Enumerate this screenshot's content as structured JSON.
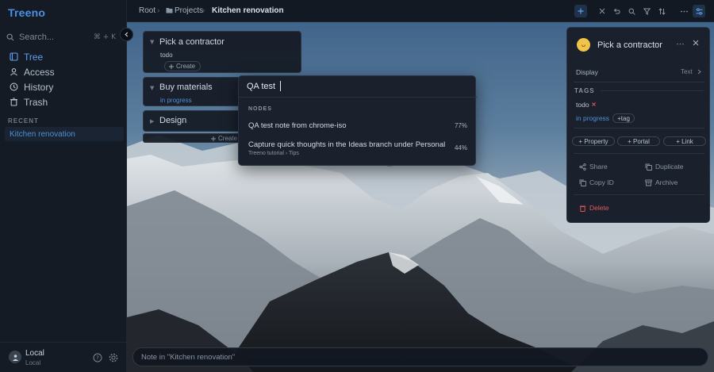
{
  "app": {
    "name": "Treeno"
  },
  "sidebar": {
    "search_label": "Search...",
    "search_shortcut": "⌘ + K",
    "items": [
      {
        "label": "Tree",
        "icon": "tree-icon",
        "active": true
      },
      {
        "label": "Access",
        "icon": "user-icon",
        "active": false
      },
      {
        "label": "History",
        "icon": "clock-icon",
        "active": false
      },
      {
        "label": "Trash",
        "icon": "trash-icon",
        "active": false
      }
    ],
    "recent_header": "RECENT",
    "recent_items": [
      "Kitchen renovation"
    ],
    "user": {
      "name": "Local",
      "sub": "Local"
    }
  },
  "breadcrumb": {
    "root": "Root",
    "projects": "Projects",
    "current": "Kitchen renovation"
  },
  "nodes": [
    {
      "title": "Pick a contractor",
      "tag": "todo",
      "create_label": "Create"
    },
    {
      "title": "Buy materials",
      "tag": "in progress"
    },
    {
      "title": "Design",
      "create_label": "Create"
    }
  ],
  "palette": {
    "query": "QA test",
    "section": "NODES",
    "results": [
      {
        "title": "QA test note from chrome-iso",
        "score": "77%"
      },
      {
        "title": "Capture quick thoughts in the Ideas branch under Personal, the...",
        "subtitle": "Treeno tutorial › Tips",
        "score": "44%"
      }
    ]
  },
  "panel": {
    "title": "Pick a contractor",
    "display_label": "Display",
    "display_value": "Text",
    "tags_header": "TAGS",
    "tags": [
      "todo"
    ],
    "tag_link": "in progress",
    "add_tag": "+tag",
    "buttons": [
      "+ Property",
      "+ Portal",
      "+ Link"
    ],
    "actions": {
      "share": "Share",
      "duplicate": "Duplicate",
      "copy_id": "Copy ID",
      "archive": "Archive",
      "delete": "Delete"
    }
  },
  "note_input": {
    "placeholder": "Note in \"Kitchen renovation\""
  },
  "colors": {
    "accent": "#4a90e2",
    "danger": "#e05a5a",
    "panel_bg": "#1a212c"
  }
}
